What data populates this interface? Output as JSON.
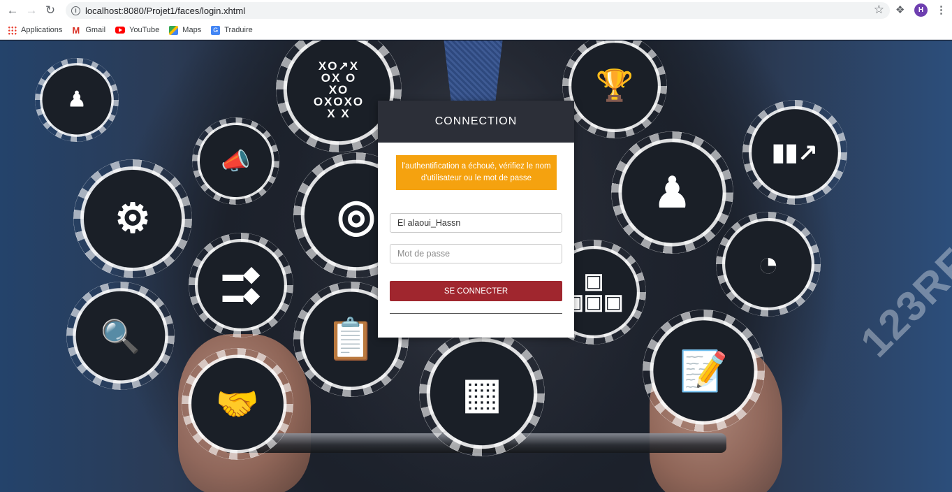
{
  "browser": {
    "url": "localhost:8080/Projet1/faces/login.xhtml",
    "profile_initial": "H",
    "bookmarks": [
      {
        "label": "Applications",
        "icon": "apps-grid-icon"
      },
      {
        "label": "Gmail",
        "icon": "gmail-icon"
      },
      {
        "label": "YouTube",
        "icon": "youtube-icon"
      },
      {
        "label": "Maps",
        "icon": "maps-icon"
      },
      {
        "label": "Traduire",
        "icon": "translate-icon"
      }
    ]
  },
  "login": {
    "title": "CONNECTION",
    "error_message": "l'authentification a échoué, vérifiez le nom d'utilisateur ou le mot de passe",
    "username_value": "El alaoui_Hassn",
    "password_placeholder": "Mot de passe",
    "submit_label": "SE CONNECTER"
  },
  "colors": {
    "header_bg": "#2c2f38",
    "error_bg": "#f5a20f",
    "button_bg": "#a0262e"
  },
  "background": {
    "watermark": "123RF",
    "gear_icons": [
      "team-icon",
      "tic-tac-toe-strategy-icon",
      "trophy-icon",
      "growth-chart-icon",
      "megaphone-icon",
      "gears-icon",
      "target-icon",
      "businessman-icon",
      "flowchart-icon",
      "pie-chart-icon",
      "network-icon",
      "clipboard-report-icon",
      "report-magnifier-icon",
      "abacus-icon",
      "handshake-icon",
      "contract-signing-icon"
    ]
  }
}
